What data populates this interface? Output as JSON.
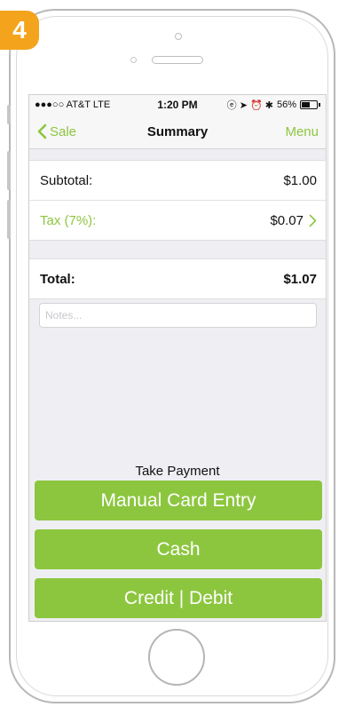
{
  "step_number": "4",
  "status_bar": {
    "carrier": "●●●○○ AT&T  LTE",
    "time": "1:20 PM",
    "indicators": "ⓔ ➤ ⏰ ✱",
    "battery_percent": "56%",
    "battery_level": 0.56
  },
  "nav": {
    "back_label": "Sale",
    "title": "Summary",
    "menu_label": "Menu"
  },
  "summary": {
    "subtotal_label": "Subtotal:",
    "subtotal_value": "$1.00",
    "tax_label": "Tax (7%):",
    "tax_value": "$0.07",
    "total_label": "Total:",
    "total_value": "$1.07"
  },
  "notes": {
    "placeholder": "Notes..."
  },
  "payment": {
    "heading": "Take Payment",
    "manual_label": "Manual Card Entry",
    "cash_label": "Cash",
    "credit_label": "Credit | Debit"
  },
  "colors": {
    "accent": "#8cc63f",
    "badge": "#f3a41c"
  }
}
